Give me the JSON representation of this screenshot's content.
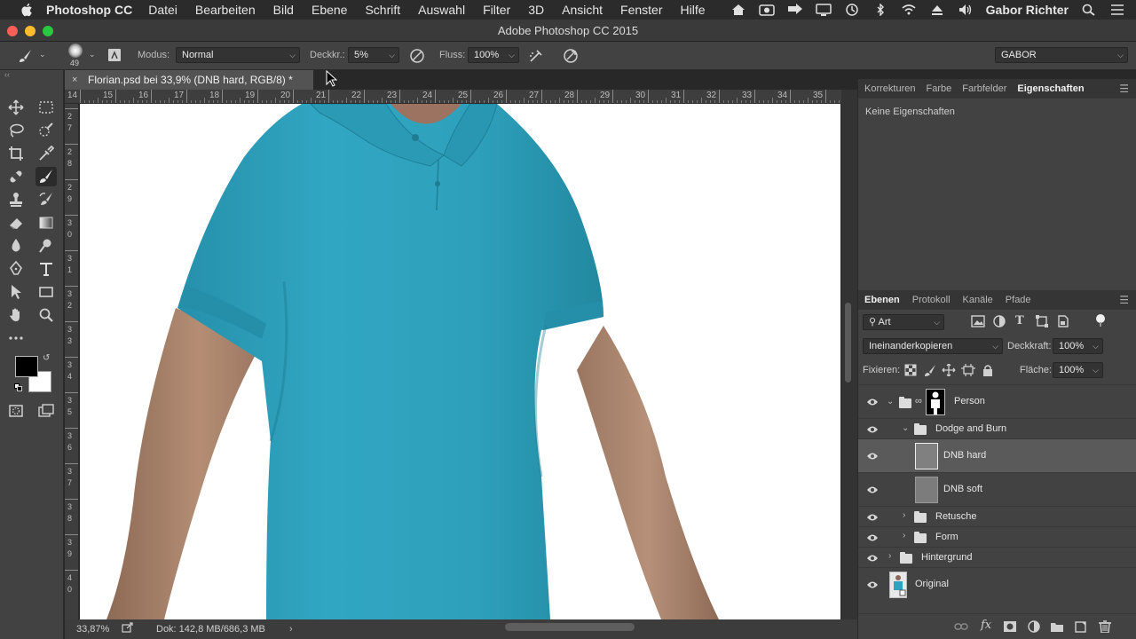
{
  "menubar": {
    "app_name": "Photoshop CC",
    "items": [
      "Datei",
      "Bearbeiten",
      "Bild",
      "Ebene",
      "Schrift",
      "Auswahl",
      "Filter",
      "3D",
      "Ansicht",
      "Fenster",
      "Hilfe"
    ],
    "user": "Gabor Richter"
  },
  "window": {
    "title": "Adobe Photoshop CC 2015"
  },
  "options": {
    "brush_size": "49",
    "modus_label": "Modus:",
    "modus_value": "Normal",
    "deckkr_label": "Deckkr.:",
    "deckkr_value": "5%",
    "fluss_label": "Fluss:",
    "fluss_value": "100%",
    "workspace": "GABOR"
  },
  "document": {
    "tab_title": "Florian.psd bei 33,9% (DNB hard, RGB/8) *",
    "h_ruler": [
      "14",
      "15",
      "16",
      "17",
      "18",
      "19",
      "20",
      "21",
      "22",
      "23",
      "24",
      "25",
      "26",
      "27",
      "28",
      "29",
      "30",
      "31",
      "32",
      "33",
      "34",
      "35"
    ],
    "v_ruler": [
      "2\n7",
      "2\n8",
      "2\n9",
      "3\n0",
      "3\n1",
      "3\n2",
      "3\n3",
      "3\n4",
      "3\n5",
      "3\n6",
      "3\n7",
      "3\n8",
      "3\n9",
      "4\n0"
    ]
  },
  "status": {
    "zoom": "33,87%",
    "doc_info": "Dok: 142,8 MB/686,3 MB"
  },
  "properties_panel": {
    "tabs": [
      "Korrekturen",
      "Farbe",
      "Farbfelder",
      "Eigenschaften"
    ],
    "active_tab": "Eigenschaften",
    "empty_text": "Keine Eigenschaften"
  },
  "layers_panel": {
    "tabs": [
      "Ebenen",
      "Protokoll",
      "Kanäle",
      "Pfade"
    ],
    "active_tab": "Ebenen",
    "filter_label": "Art",
    "blend_mode": "Ineinanderkopieren",
    "opacity_label": "Deckkraft:",
    "opacity_value": "100%",
    "lock_label": "Fixieren:",
    "fill_label": "Fläche:",
    "fill_value": "100%",
    "layers": [
      {
        "name": "Person",
        "type": "group-mask",
        "expanded": true
      },
      {
        "name": "Dodge and Burn",
        "type": "group",
        "expanded": true
      },
      {
        "name": "DNB hard",
        "type": "layer",
        "selected": true
      },
      {
        "name": "DNB soft",
        "type": "layer"
      },
      {
        "name": "Retusche",
        "type": "group",
        "expanded": false
      },
      {
        "name": "Form",
        "type": "group",
        "expanded": false
      },
      {
        "name": "Hintergrund",
        "type": "group",
        "expanded": false
      },
      {
        "name": "Original",
        "type": "smart-object"
      }
    ]
  },
  "colors": {
    "shirt": "#2ea2be",
    "skin": "#a9826b",
    "panel": "#424242",
    "selected_row": "#5a5a5a"
  }
}
